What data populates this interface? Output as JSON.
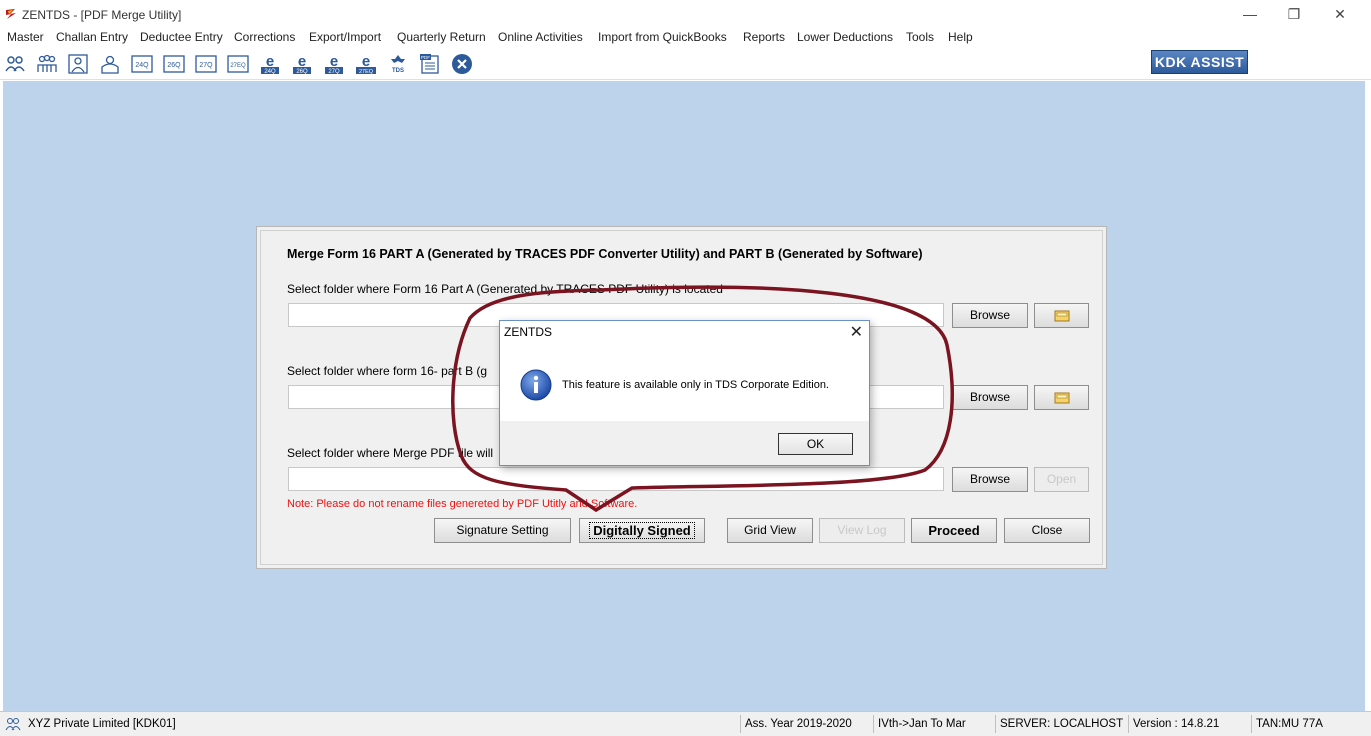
{
  "window": {
    "title": "ZENTDS - [PDF Merge Utility]",
    "controls": [
      "minimize",
      "restore",
      "close"
    ]
  },
  "menu": [
    "Master",
    "Challan Entry",
    "Deductee Entry",
    "Corrections",
    "Export/Import",
    "Quarterly Return",
    "Online Activities",
    "Import from QuickBooks",
    "Reports",
    "Lower Deductions",
    "Tools",
    "Help"
  ],
  "toolbar": {
    "icons": [
      {
        "name": "deductor-icon",
        "label": ""
      },
      {
        "name": "deductee-group-icon",
        "label": ""
      },
      {
        "name": "employee-icon",
        "label": ""
      },
      {
        "name": "person-icon",
        "label": ""
      },
      {
        "name": "form-24q-icon",
        "label": "24Q"
      },
      {
        "name": "form-26q-icon",
        "label": "26Q"
      },
      {
        "name": "form-27q-icon",
        "label": "27Q"
      },
      {
        "name": "form-27eq-icon",
        "label": "27EQ"
      },
      {
        "name": "efile-24q-icon",
        "label": "24Q"
      },
      {
        "name": "efile-26q-icon",
        "label": "26Q"
      },
      {
        "name": "efile-27q-icon",
        "label": "27Q"
      },
      {
        "name": "efile-27eq-icon",
        "label": "27EQ"
      },
      {
        "name": "tds-icon",
        "label": "TDS"
      },
      {
        "name": "pdf-icon",
        "label": "PDF"
      },
      {
        "name": "exit-icon",
        "label": ""
      }
    ],
    "kdk_assist": "KDK ASSIST"
  },
  "panel": {
    "title": "Merge Form 16 PART A (Generated by TRACES PDF Converter Utility) and PART B (Generated by Software)",
    "label_part_a": "Select folder where Form 16 Part A (Generated by TRACES PDF Utility) is located",
    "label_part_b": "Select folder where form 16- part B (g",
    "label_merge": "Select folder where Merge PDF file will",
    "browse": "Browse",
    "open": "Open",
    "note": "Note: Please do not rename files genereted by PDF Utitly and Software.",
    "buttons": {
      "signature_setting": "Signature Setting",
      "digitally_signed": "Digitally Signed",
      "grid_view": "Grid View",
      "view_log": "View Log",
      "proceed": "Proceed",
      "close": "Close"
    }
  },
  "dialog": {
    "title": "ZENTDS",
    "message": "This feature is available only in TDS Corporate Edition.",
    "ok": "OK"
  },
  "status": {
    "company": "XYZ Private Limited [KDK01]",
    "ass_year": "Ass. Year 2019-2020",
    "quarter": "IVth->Jan To Mar",
    "server": "SERVER: LOCALHOST",
    "version": "Version : 14.8.21",
    "tan": "TAN:MU        77A"
  },
  "colors": {
    "workspace": "#bdd3ec",
    "callout_outline": "#7a1420",
    "note_text": "#e11111",
    "kdk_button": "#2d5a9b"
  }
}
